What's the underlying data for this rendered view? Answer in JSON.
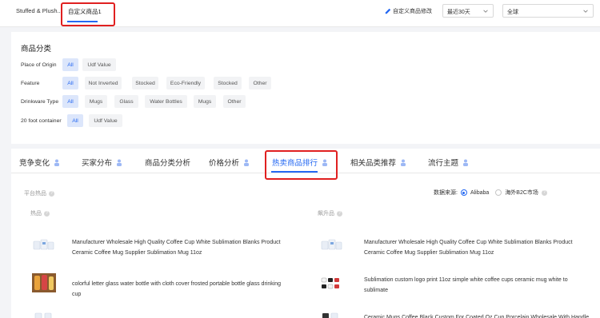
{
  "topbar": {
    "tabs": [
      "Stuffed & Plush...",
      "自定义商品1"
    ],
    "edit_label": "自定义商品修改",
    "time_select": "最近30天",
    "region_select": "全球"
  },
  "category": {
    "title": "商品分类",
    "rows": [
      {
        "label": "Place of Origin",
        "chips": [
          "All",
          "Udf Value"
        ]
      },
      {
        "label": "Feature",
        "chips": [
          "All",
          "Not Inverted",
          "Stocked",
          "Eco-Friendly",
          "Stocked",
          "Other"
        ]
      },
      {
        "label": "Drinkware Type",
        "chips": [
          "All",
          "Mugs",
          "Glass",
          "Water Bottles",
          "Mugs",
          "Other"
        ]
      },
      {
        "label": "20 foot container",
        "chips": [
          "All",
          "Udf Value"
        ]
      }
    ]
  },
  "tabs": [
    "竞争变化",
    "买家分布",
    "商品分类分析",
    "价格分析",
    "热卖商品排行",
    "相关品类推荐",
    "流行主题"
  ],
  "section": {
    "platform_hot": "平台热品",
    "data_source_label": "数据来源:",
    "source_options": [
      "Alibaba",
      "海外B2C市场"
    ],
    "hot_label": "热品",
    "rising_label": "飙升品"
  },
  "products_left": [
    "Manufacturer Wholesale High Quality Coffee Cup White Sublimation Blanks Product Ceramic Coffee Mug Supplier Sublimation Mug 11oz",
    "colorful letter glass water bottle with cloth cover frosted portable bottle glass drinking cup"
  ],
  "products_right": [
    "Manufacturer Wholesale High Quality Coffee Cup White Sublimation Blanks Product Ceramic Coffee Mug Supplier Sublimation Mug 11oz",
    "Sublimation custom logo print 11oz simple white coffee cups ceramic mug white to sublimate",
    "Ceramic Mugs Coffee Black Custom For Coated Oz Cup Porcelain Wholesale With Handle"
  ],
  "colors": {
    "accent": "#2468f2",
    "highlight": "#e02020"
  }
}
